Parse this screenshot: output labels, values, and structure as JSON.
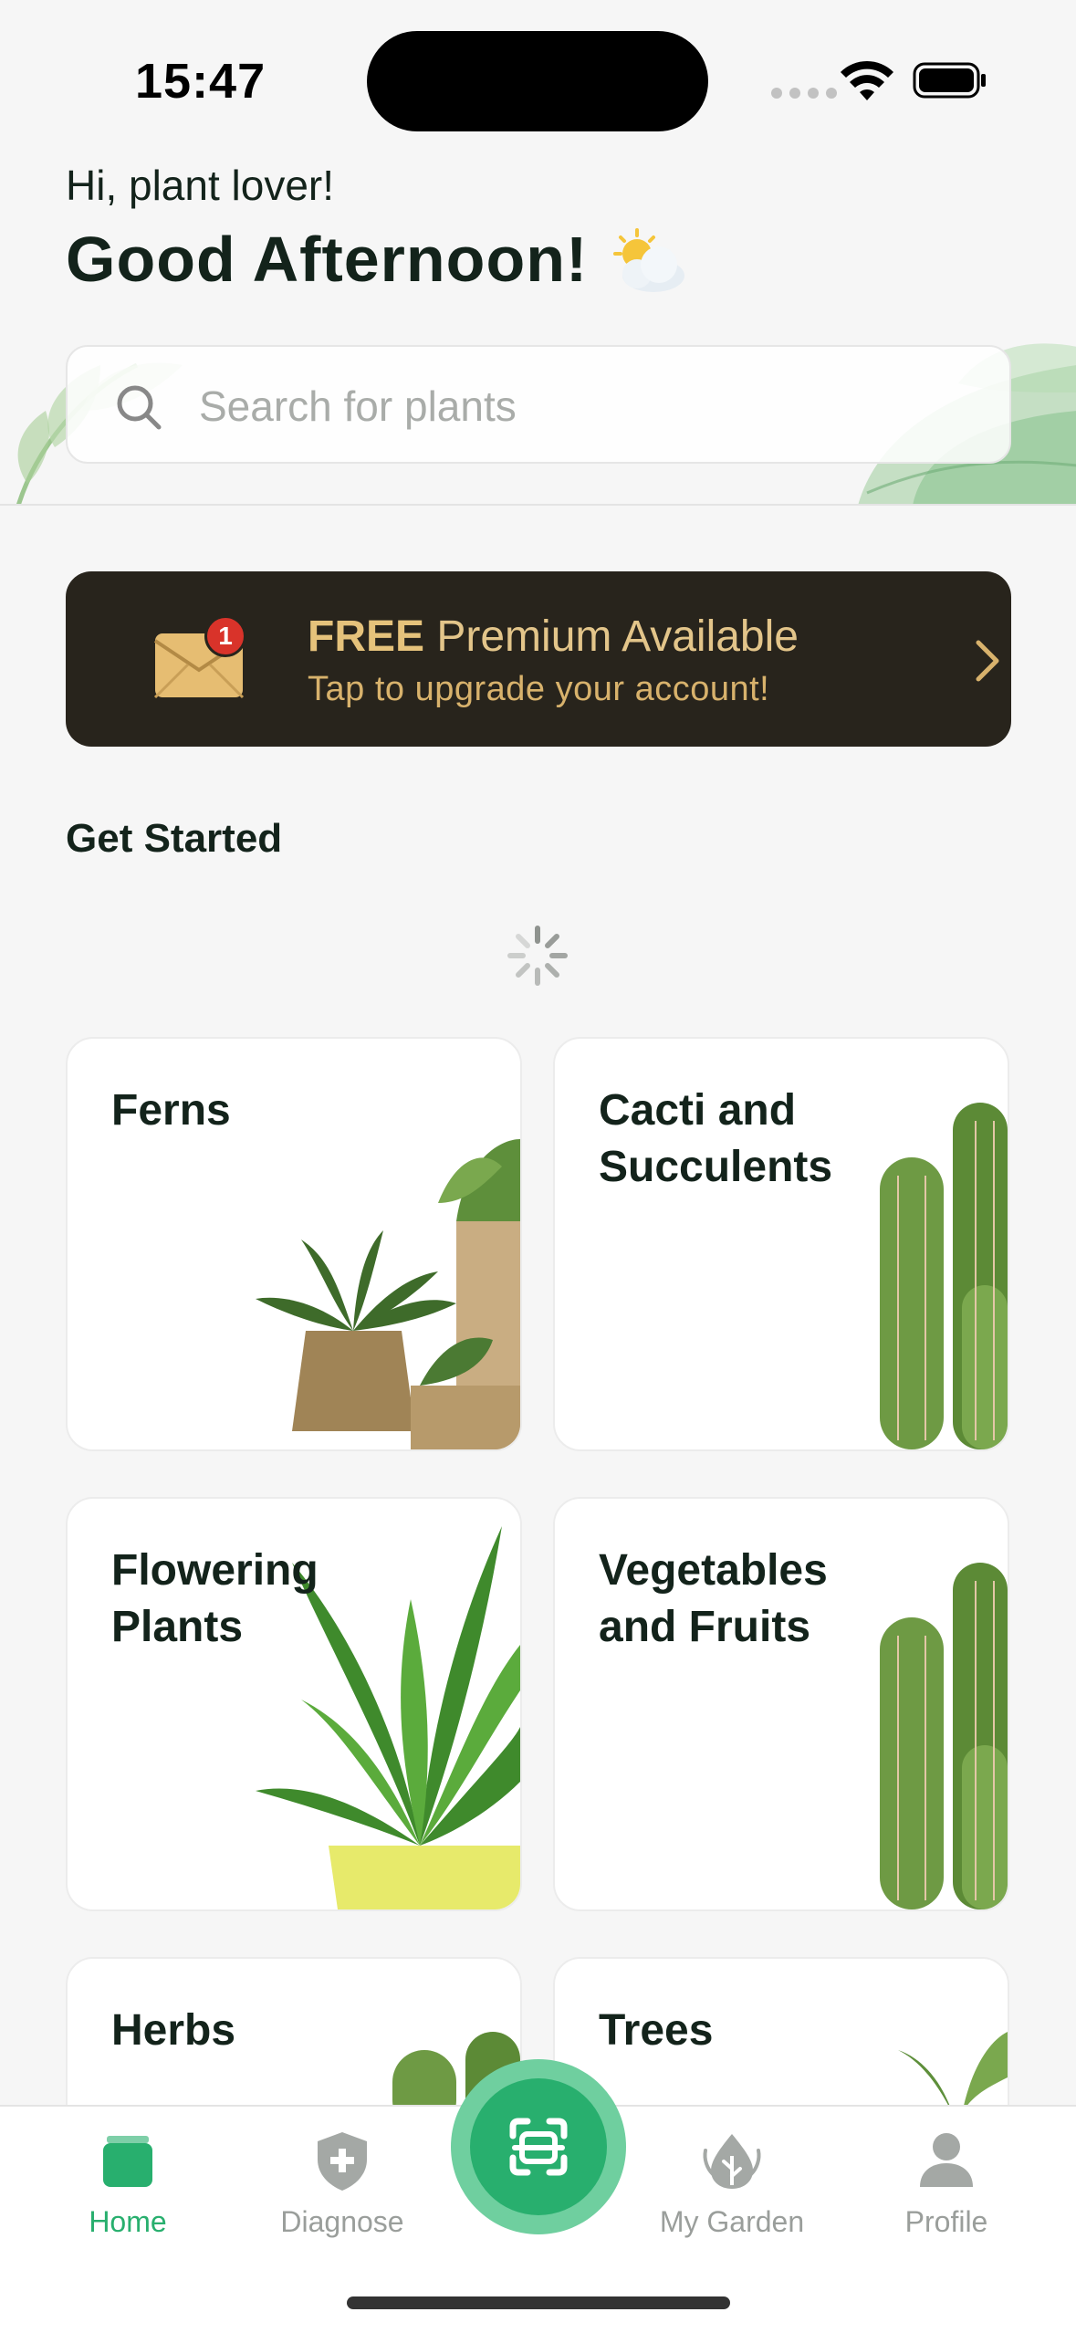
{
  "status_bar": {
    "time": "15:47"
  },
  "header": {
    "greeting_small": "Hi, plant lover!",
    "greeting_big": "Good Afternoon!",
    "weather_icon": "sun-behind-cloud-icon"
  },
  "search": {
    "placeholder": "Search for plants"
  },
  "promo": {
    "title_bold": "FREE",
    "title_rest": " Premium Available",
    "subtitle": "Tap to upgrade your account!",
    "badge_count": "1"
  },
  "get_started": {
    "title": "Get Started",
    "categories": [
      {
        "label": "Ferns",
        "art": "fern-pots"
      },
      {
        "label": "Cacti and Succulents",
        "art": "cactus"
      },
      {
        "label": "Flowering Plants",
        "art": "potted-plant"
      },
      {
        "label": "Vegetables and Fruits",
        "art": "cactus"
      },
      {
        "label": "Herbs",
        "art": "cactus"
      },
      {
        "label": "Trees",
        "art": "fern"
      }
    ]
  },
  "tabbar": {
    "tabs": [
      {
        "label": "Home",
        "icon": "home-icon",
        "active": true
      },
      {
        "label": "Diagnose",
        "icon": "shield-plus-icon",
        "active": false
      },
      {
        "label": "My Garden",
        "icon": "leaf-drop-icon",
        "active": false
      },
      {
        "label": "Profile",
        "icon": "person-icon",
        "active": false
      }
    ],
    "scan_icon": "scan-icon"
  },
  "colors": {
    "accent": "#28af6e",
    "promo_bg": "#28241c",
    "promo_text": "#e5c27b",
    "background": "#f6f6f6"
  }
}
